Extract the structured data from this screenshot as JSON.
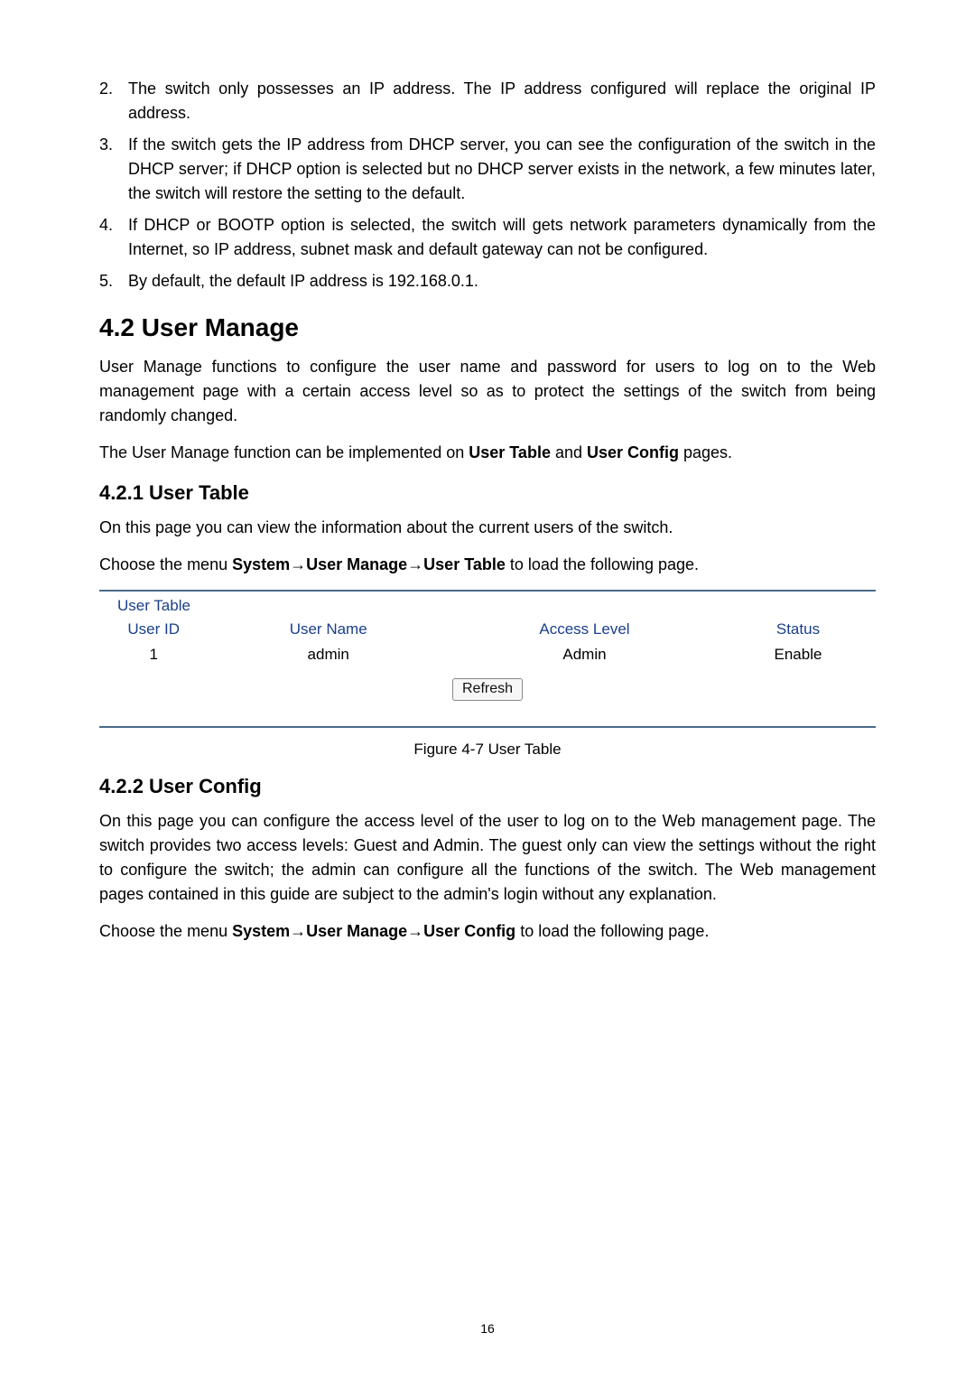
{
  "notes": [
    {
      "n": "2.",
      "t": "The switch only possesses an IP address. The IP address configured will replace the original IP address."
    },
    {
      "n": "3.",
      "t": "If the switch gets the IP address from DHCP server, you can see the configuration of the switch in the DHCP server; if DHCP option is selected but no DHCP server exists in the network, a few minutes later, the switch will restore the setting to the default."
    },
    {
      "n": "4.",
      "t": "If DHCP or BOOTP option is selected, the switch will gets network parameters dynamically from the Internet, so IP address, subnet mask and default gateway can not be configured."
    },
    {
      "n": "5.",
      "t": "By default, the default IP address is 192.168.0.1."
    }
  ],
  "sec42": {
    "heading": "4.2  User Manage",
    "p1": "User Manage functions to configure the user name and password for users to log on to the Web management page with a certain access level so as to protect the settings of the switch from being randomly changed.",
    "p2_pre": "The User Manage function can be implemented on ",
    "p2_b1": "User Table",
    "p2_mid": " and ",
    "p2_b2": "User Config",
    "p2_post": " pages."
  },
  "sec421": {
    "heading": "4.2.1 User Table",
    "p1": "On this page you can view the information about the current users of the switch.",
    "p2_pre": "Choose the menu ",
    "p2_b": "System→User Manage→User Table",
    "p2_post": " to load the following page."
  },
  "user_table": {
    "title": "User Table",
    "headers": {
      "id": "User ID",
      "name": "User Name",
      "level": "Access Level",
      "status": "Status"
    },
    "row": {
      "id": "1",
      "name": "admin",
      "level": "Admin",
      "status": "Enable"
    },
    "refresh": "Refresh",
    "caption": "Figure 4-7 User Table"
  },
  "sec422": {
    "heading": "4.2.2 User Config",
    "p1": "On this page you can configure the access level of the user to log on to the Web management page. The switch provides two access levels: Guest and Admin. The guest only can view the settings without the right to configure the switch; the admin can configure all the functions of the switch. The Web management pages contained in this guide are subject to the admin's login without any explanation.",
    "p2_pre": "Choose the menu ",
    "p2_b": "System→User Manage→User Config",
    "p2_post": " to load the following page."
  },
  "page_number": "16"
}
